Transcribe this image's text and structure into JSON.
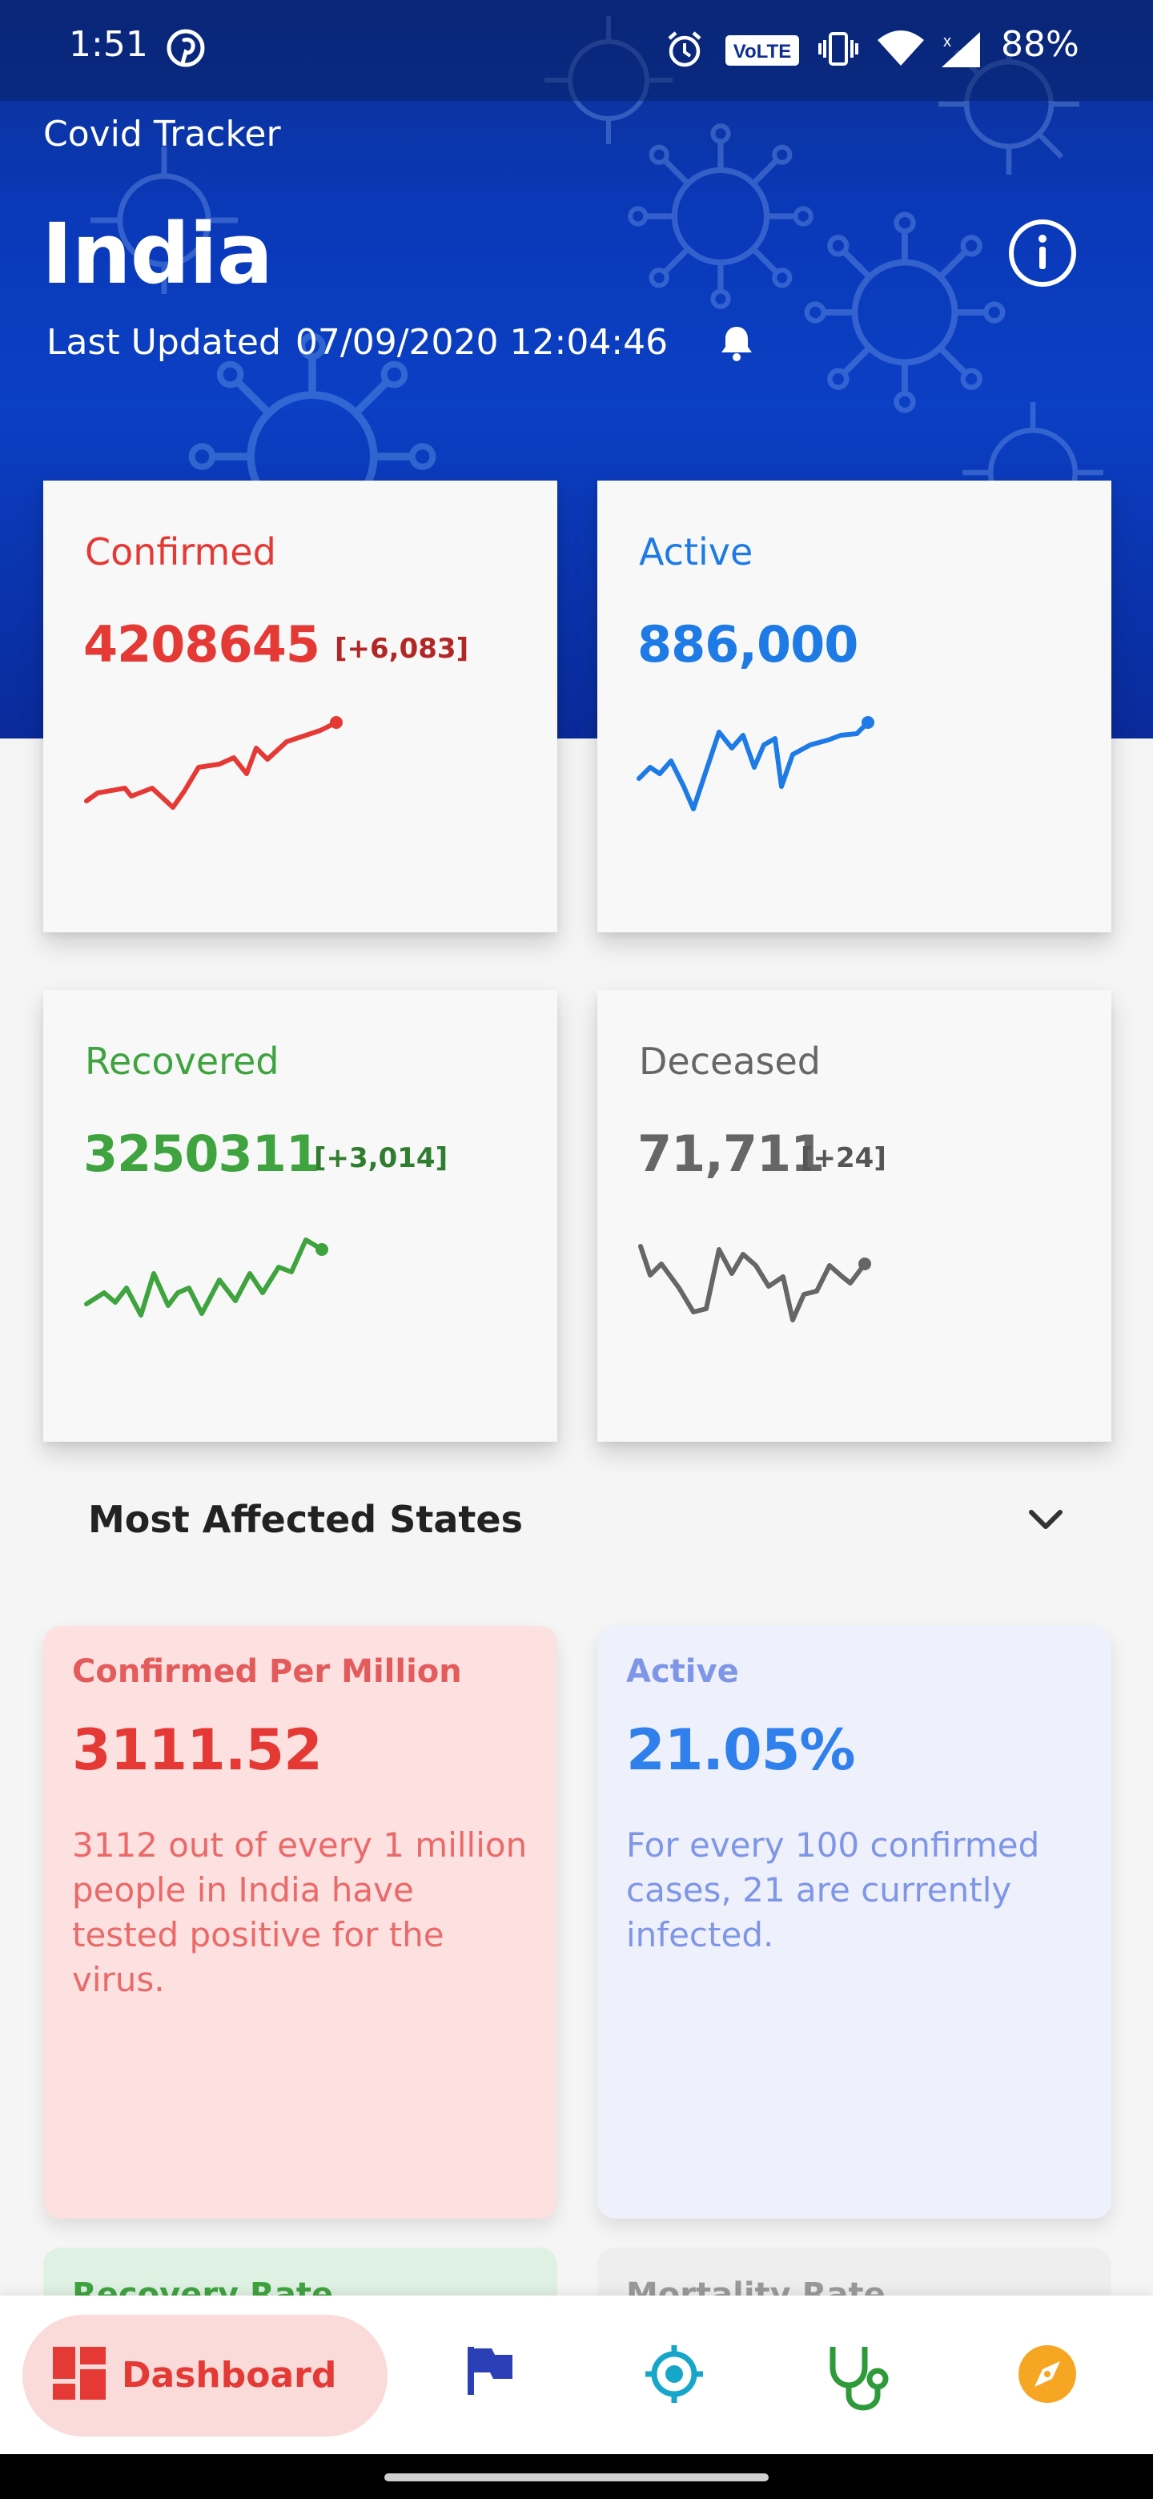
{
  "status_bar": {
    "time": "1:51",
    "battery": "88%",
    "icons": [
      "pinterest-icon",
      "alarm-icon",
      "volte-icon",
      "vibrate-icon",
      "wifi-icon",
      "signal-icon"
    ]
  },
  "header": {
    "app_title": "Covid Tracker",
    "country": "India",
    "last_updated_label": "Last Updated",
    "last_updated_value": "07/09/2020 12:04:46"
  },
  "stats": {
    "confirmed": {
      "label": "Confirmed",
      "value": "4208645",
      "delta": "[+6,083]",
      "color": "#e53935"
    },
    "active": {
      "label": "Active",
      "value": "886,000",
      "color": "#1e7be6"
    },
    "recovered": {
      "label": "Recovered",
      "value": "3250311",
      "delta": "[+3,014]",
      "color": "#3fa33f"
    },
    "deceased": {
      "label": "Deceased",
      "value": "71,711",
      "delta": "[+24]",
      "color": "#666666"
    }
  },
  "section": {
    "title": "Most Affected States"
  },
  "info_cards": {
    "confirmed_per_million": {
      "title": "Confirmed Per Million",
      "value": "3111.52",
      "description": "3112 out of every 1 million people in India have tested positive for the virus."
    },
    "active_percent": {
      "title": "Active",
      "value": "21.05%",
      "description": "For every 100 confirmed cases, 21 are currently infected."
    },
    "recovery_rate": {
      "title": "Recovery Rate"
    },
    "mortality_rate": {
      "title": "Mortality Rate"
    }
  },
  "bottom_nav": {
    "active_label": "Dashboard",
    "items": [
      "dashboard-icon",
      "flag-icon",
      "target-icon",
      "stethoscope-icon",
      "compass-icon"
    ]
  },
  "colors": {
    "header_blue": "#0b3fc4",
    "confirmed_red": "#e53935",
    "active_blue": "#1e7be6",
    "recovered_green": "#3fa33f",
    "deceased_gray": "#666666"
  }
}
